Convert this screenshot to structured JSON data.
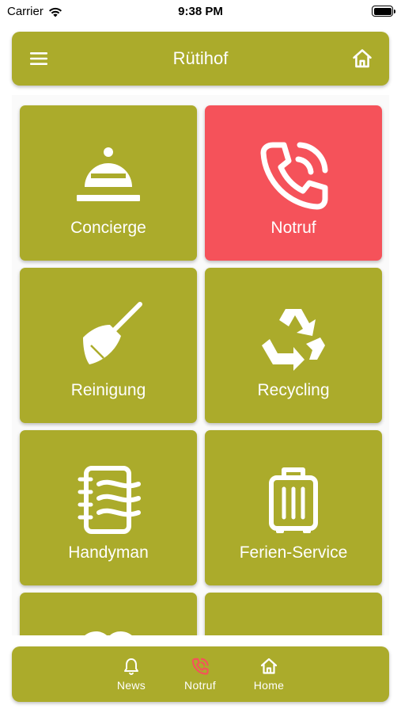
{
  "status_bar": {
    "carrier": "Carrier",
    "time": "9:38 PM"
  },
  "colors": {
    "olive": "#ABAB2B",
    "red": "#F5525A",
    "white": "#FFFFFF"
  },
  "header": {
    "title": "Rütihof",
    "left_icon": "menu-icon",
    "right_icon": "home-icon"
  },
  "tiles": [
    {
      "label": "Concierge",
      "icon": "cloche-icon",
      "color": "#ABAB2B"
    },
    {
      "label": "Notruf",
      "icon": "phone-call-icon",
      "color": "#F5525A"
    },
    {
      "label": "Reinigung",
      "icon": "broom-icon",
      "color": "#ABAB2B"
    },
    {
      "label": "Recycling",
      "icon": "recycle-icon",
      "color": "#ABAB2B"
    },
    {
      "label": "Handyman",
      "icon": "notebook-icon",
      "color": "#ABAB2B"
    },
    {
      "label": "Ferien-Service",
      "icon": "suitcase-icon",
      "color": "#ABAB2B"
    }
  ],
  "bottom_nav": [
    {
      "label": "News",
      "icon": "bell-icon",
      "icon_color": "#FFFFFF"
    },
    {
      "label": "Notruf",
      "icon": "phone-call-icon",
      "icon_color": "#F5525A"
    },
    {
      "label": "Home",
      "icon": "home-icon",
      "icon_color": "#FFFFFF"
    }
  ]
}
